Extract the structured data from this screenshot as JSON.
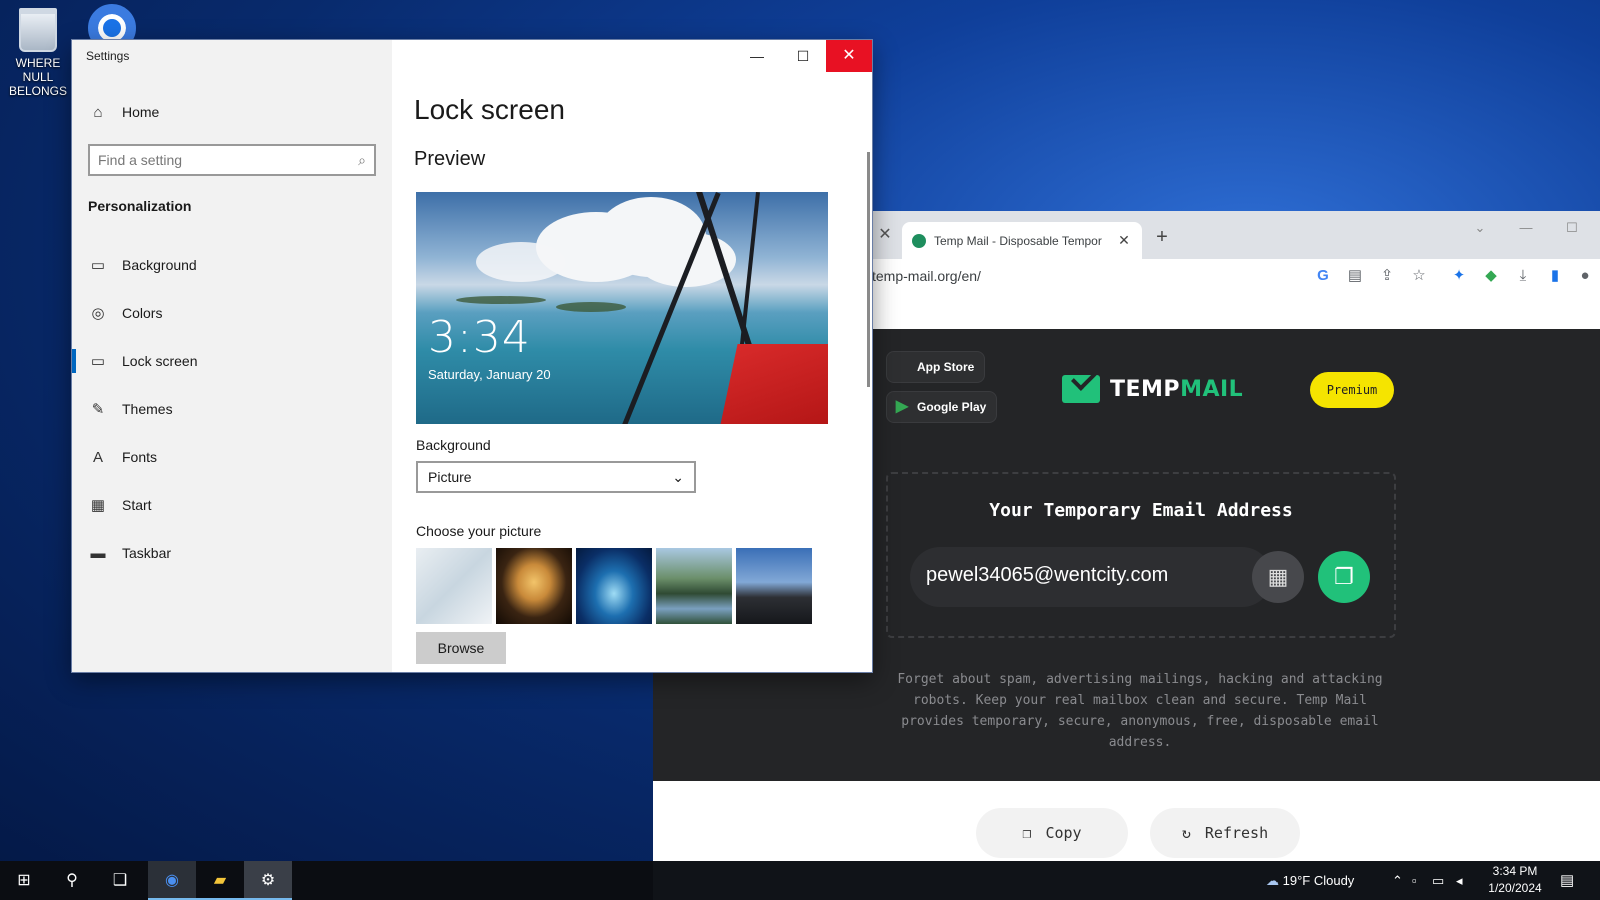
{
  "desktop": {
    "icons": [
      {
        "label": "WHERE NULL BELONGS",
        "icon": "recycle-bin-icon"
      },
      {
        "label": "",
        "icon": "chrome-icon"
      }
    ]
  },
  "settings": {
    "window_title": "Settings",
    "home": "Home",
    "search_placeholder": "Find a setting",
    "group": "Personalization",
    "nav": [
      {
        "label": "Background",
        "icon": "picture-icon"
      },
      {
        "label": "Colors",
        "icon": "palette-icon"
      },
      {
        "label": "Lock screen",
        "icon": "lock-screen-icon",
        "active": true
      },
      {
        "label": "Themes",
        "icon": "brush-icon"
      },
      {
        "label": "Fonts",
        "icon": "fonts-icon"
      },
      {
        "label": "Start",
        "icon": "start-icon"
      },
      {
        "label": "Taskbar",
        "icon": "taskbar-icon"
      }
    ],
    "page_title": "Lock screen",
    "preview_heading": "Preview",
    "preview_time": "3:34",
    "preview_date": "Saturday, January 20",
    "background_label": "Background",
    "background_value": "Picture",
    "choose_label": "Choose your picture",
    "browse_label": "Browse"
  },
  "browser": {
    "tab_title": "Temp Mail - Disposable Tempor",
    "url": "temp-mail.org/en/",
    "new_tab": "+"
  },
  "tempmail": {
    "app_store": "App Store",
    "google_play": "Google Play",
    "logo_temp": "TEMP",
    "logo_mail": "MAIL",
    "premium": "Premium",
    "heading": "Your Temporary Email Address",
    "email": "pewel34065@wentcity.com",
    "description": "Forget about spam, advertising mailings, hacking and attacking robots. Keep your real mailbox clean and secure. Temp Mail provides temporary, secure, anonymous, free, disposable email address.",
    "copy": "Copy",
    "refresh": "Refresh",
    "accent": "#21c17a",
    "premium_color": "#f5e400"
  },
  "taskbar": {
    "weather": "19°F  Cloudy",
    "time": "3:34 PM",
    "date": "1/20/2024"
  }
}
